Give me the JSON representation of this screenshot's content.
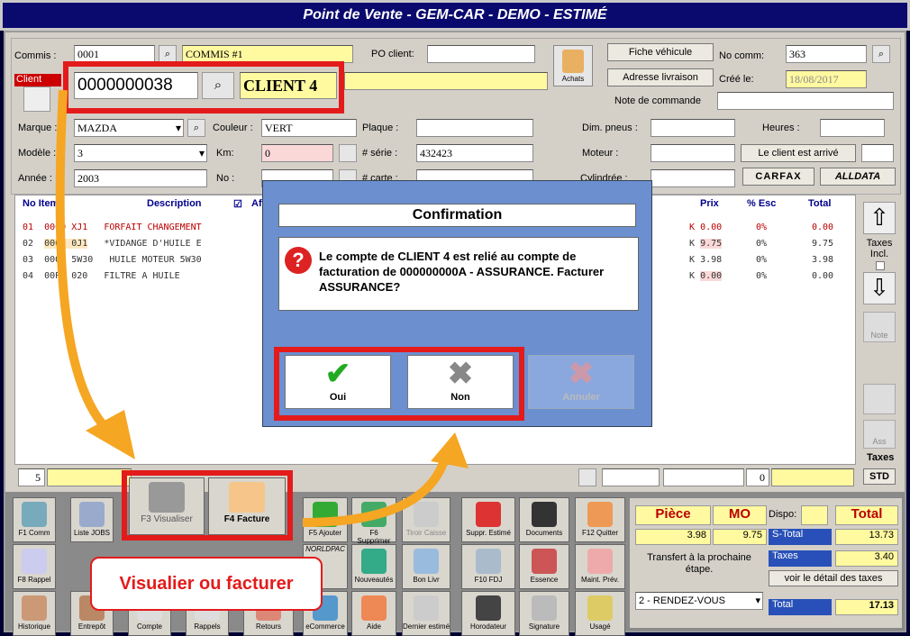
{
  "window": {
    "title": "Point de Vente - GEM-CAR - DEMO - ESTIMÉ"
  },
  "header": {
    "commis_label": "Commis :",
    "commis_code": "0001",
    "commis_name": "COMMIS #1",
    "po_label": "PO client:",
    "fiche_label": "Fiche véhicule",
    "adresse_label": "Adresse livraison",
    "no_comm_label": "No comm:",
    "no_comm_value": "363",
    "cree_label": "Créé le:",
    "cree_value": "18/08/2017",
    "note_label": "Note de commande",
    "achats_label": "Achats",
    "client_label": "Client",
    "client_code": "0000000038",
    "client_name": "CLIENT 4",
    "marque_label": "Marque :",
    "marque_value": "MAZDA",
    "couleur_label": "Couleur :",
    "couleur_value": "VERT",
    "plaque_label": "Plaque :",
    "dim_label": "Dim. pneus :",
    "heures_label": "Heures :",
    "modele_label": "Modèle :",
    "modele_value": "3",
    "km_label": "Km:",
    "km_value": "0",
    "serie_label": "# série :",
    "serie_value": "432423",
    "moteur_label": "Moteur :",
    "arrive_label": "Le client est arrivé",
    "annee_label": "Année :",
    "annee_value": "2003",
    "no_label": "No :",
    "carte_label": "# carte :",
    "cyl_label": "Cylindrée :",
    "carfax": "CARFAX",
    "alldata": "ALLDATA"
  },
  "grid": {
    "headers": {
      "no": "No Item",
      "desc": "Description",
      "affi": "Affi",
      "prix": "Prix",
      "esc": "% Esc",
      "total": "Total"
    },
    "rows": [
      {
        "n": "01",
        "item": "0000 XJ1",
        "desc": "FORFAIT CHANGEMENT",
        "k": "K",
        "prix": "0.00",
        "esc": "0%",
        "total": "0.00",
        "red": true
      },
      {
        "n": "02",
        "item": "0000 0J1",
        "desc": "*VIDANGE D'HUILE E",
        "k": "K",
        "prix": "9.75",
        "esc": "0%",
        "total": "9.75"
      },
      {
        "n": "03",
        "item": "0000 5W30",
        "desc": "HUILE MOTEUR 5W30",
        "k": "K",
        "prix": "3.98",
        "esc": "0%",
        "total": "3.98"
      },
      {
        "n": "04",
        "item": "00PH 020",
        "desc": "FILTRE A HUILE",
        "k": "K",
        "prix": "0.00",
        "esc": "0%",
        "total": "0.00"
      }
    ],
    "side": {
      "taxes_incl": "Taxes Incl.",
      "note": "Note",
      "ass": "Ass",
      "taxes": "Taxes",
      "std": "STD"
    },
    "count": "5",
    "zero": "0"
  },
  "dialog": {
    "title": "Confirmation",
    "message": "Le compte de CLIENT 4 est relié au compte de facturation de 000000000A - ASSURANCE. Facturer ASSURANCE?",
    "oui": "Oui",
    "non": "Non",
    "annuler": "Annuler"
  },
  "toolbar": [
    [
      "F1 Comm",
      "Liste JOBS",
      "F3 Visualiser",
      "F4 Facture",
      "F5 Ajouter",
      "F6 Supprimer",
      "Tiroir Caisse",
      "Suppr. Estimé",
      "Documents",
      "F12 Quitter"
    ],
    [
      "F8 Rappel",
      "",
      "",
      "",
      "NORLDPAC",
      "Nouveautés",
      "Bon Livr",
      "F10 FDJ",
      "Essence",
      "Maint. Prév."
    ],
    [
      "Historique",
      "Entrepôt",
      "Compte",
      "Rappels",
      "Retours",
      "eCommerce",
      "Aide",
      "Dernier estimé",
      "Horodateur",
      "Signature",
      "Usagé"
    ]
  ],
  "totals": {
    "piece": "Pièce",
    "mo": "MO",
    "dispo": "Dispo:",
    "total": "Total",
    "piece_val": "3.98",
    "mo_val": "9.75",
    "stotal": "S-Total",
    "stotal_val": "13.73",
    "transfert": "Transfert à la prochaine étape.",
    "taxes": "Taxes",
    "taxes_val": "3.40",
    "detail": "voir le détail des taxes",
    "etape": "2 - RENDEZ-VOUS",
    "total_label": "Total",
    "total_val": "17.13"
  },
  "annotation": {
    "text": "Visualier ou facturer"
  },
  "colors": {
    "highlight": "#e31b1b",
    "arrow": "#f5a623"
  }
}
